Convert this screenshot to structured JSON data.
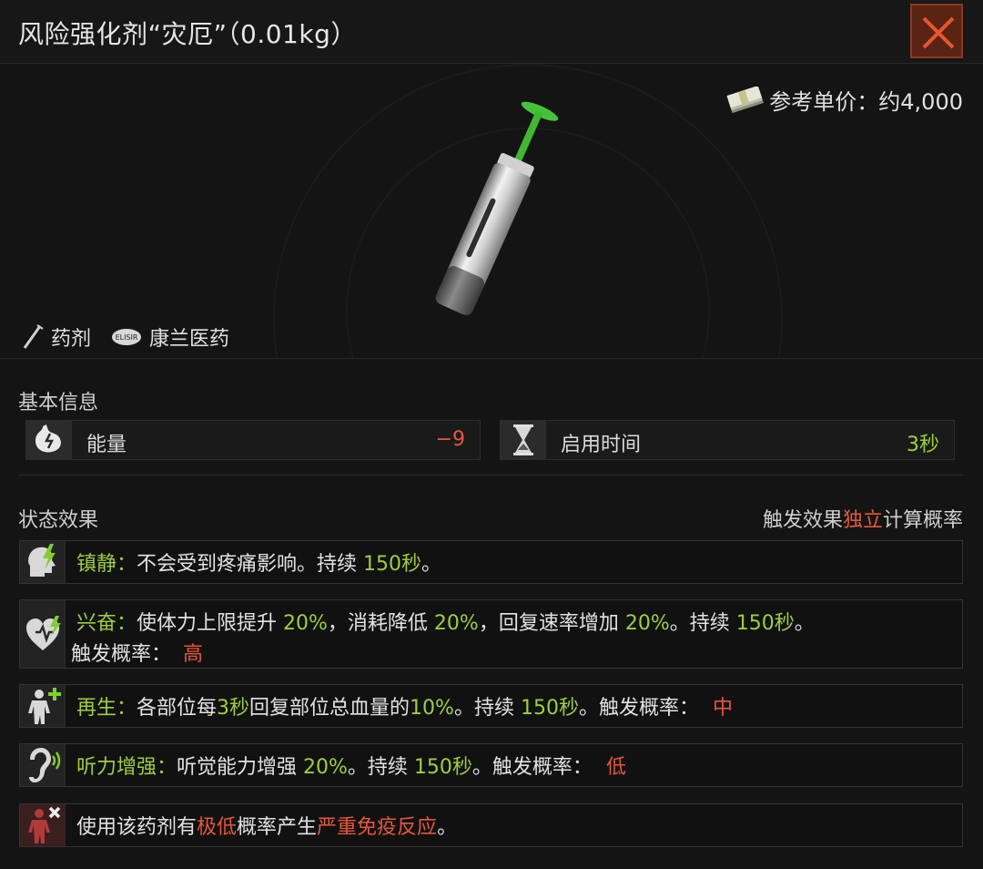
{
  "window": {
    "title": "风险强化剂“灾厄”（0.01kg）"
  },
  "price": {
    "label": "参考单价：约4,000"
  },
  "tags": [
    {
      "label": "药剂",
      "icon": "syringe-icon"
    },
    {
      "label": "康兰医药",
      "icon": "elisir-logo-icon",
      "logo_text": "ELISIR"
    }
  ],
  "basic": {
    "label": "基本信息",
    "stats": [
      {
        "label": "能量",
        "value": "−9",
        "icon": "stomach-icon",
        "color": "#e5573a"
      },
      {
        "label": "启用时间",
        "value": "3秒",
        "icon": "hourglass-icon",
        "color": "#9ccf3f"
      }
    ]
  },
  "status": {
    "label": "状态效果",
    "note_a": "触发效果",
    "note_hl": "独立",
    "note_b": "计算概率"
  },
  "effects": [
    {
      "icon": "sedation-head-icon",
      "name": "镇静：",
      "text_a": "不会受到疼痛影响。持续 ",
      "val_a": "150秒",
      "text_b": "。"
    },
    {
      "icon": "heart-bolt-icon",
      "name": "兴奋：",
      "text_a": "使体力上限提升 ",
      "val_a": "20%",
      "text_b": "，消耗降低 ",
      "val_b": "20%",
      "text_c": "，回复速率增加 ",
      "val_c": "20%",
      "text_d": "。持续 ",
      "val_d": "150秒",
      "text_e": "。",
      "chance_label": "触发概率：",
      "chance": "高"
    },
    {
      "icon": "body-plus-icon",
      "name": "再生：",
      "text_a": "各部位每",
      "val_a": "3秒",
      "text_b": "回复部位总血量的",
      "val_b": "10%",
      "text_c": "。持续 ",
      "val_c": "150秒",
      "text_d": "。触发概率：",
      "chance": "中"
    },
    {
      "icon": "ear-sound-icon",
      "name": "听力增强：",
      "text_a": "听觉能力增强 ",
      "val_a": "20%",
      "text_b": "。持续 ",
      "val_b": "150秒",
      "text_c": "。触发概率：",
      "chance": "低"
    },
    {
      "icon": "body-cross-icon",
      "text_a": "使用该药剂有",
      "hl_a": "极低",
      "text_b": "概率产生",
      "hl_b": "严重免疫反应",
      "text_c": "。"
    }
  ],
  "colors": {
    "positive": "#9ccf3f",
    "negative": "#e5573a",
    "close": "#e8552e"
  }
}
